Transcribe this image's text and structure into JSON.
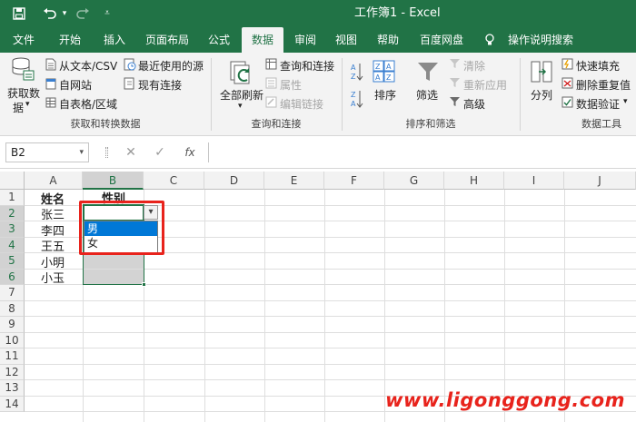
{
  "window": {
    "title": "工作簿1  -  Excel"
  },
  "quick_access": {
    "save_icon": "save-icon",
    "undo_icon": "undo-icon",
    "redo_icon": "redo-icon",
    "customize_icon": "customize-icon"
  },
  "tabs": [
    {
      "label": "文件"
    },
    {
      "label": "开始"
    },
    {
      "label": "插入"
    },
    {
      "label": "页面布局"
    },
    {
      "label": "公式"
    },
    {
      "label": "数据"
    },
    {
      "label": "审阅"
    },
    {
      "label": "视图"
    },
    {
      "label": "帮助"
    },
    {
      "label": "百度网盘"
    },
    {
      "label": "操作说明搜索"
    }
  ],
  "ribbon": {
    "get_data": {
      "line1": "获取数",
      "line2": "据",
      "arrow": "▾"
    },
    "from_text": "从文本/CSV",
    "from_web": "自网站",
    "from_table": "自表格/区域",
    "recent_sources": "最近使用的源",
    "existing_conn": "现有连接",
    "group1": "获取和转换数据",
    "refresh_all": "全部刷新",
    "refresh_arrow": "▾",
    "queries_conn": "查询和连接",
    "properties": "属性",
    "edit_links": "编辑链接",
    "group2": "查询和连接",
    "sort_az": "A Z",
    "sort_za": "Z A",
    "sort": "排序",
    "filter": "筛选",
    "clear": "清除",
    "reapply": "重新应用",
    "advanced": "高级",
    "group3": "排序和筛选",
    "split": "分列",
    "flash_fill": "快速填充",
    "remove_dup": "删除重复值",
    "data_valid": "数据验证",
    "data_valid_arrow": "▾",
    "group4": "数据工具"
  },
  "formula_bar": {
    "name_box": "B2",
    "name_box_arrow": "▾",
    "cancel": "✕",
    "enter": "✓",
    "fx": "fx",
    "value": ""
  },
  "columns": [
    "A",
    "B",
    "C",
    "D",
    "E",
    "F",
    "G",
    "H",
    "I",
    "J"
  ],
  "rows": [
    "1",
    "2",
    "3",
    "4",
    "5",
    "6",
    "7",
    "8",
    "9",
    "10",
    "11",
    "12",
    "13",
    "14"
  ],
  "cells": {
    "a1": "姓名",
    "b1": "性别",
    "a2": "张三",
    "a3": "李四",
    "a4": "王五",
    "a5": "小明",
    "a6": "小玉"
  },
  "dropdown": {
    "options": [
      "男",
      "女"
    ],
    "highlighted": 0,
    "arrow": "▾"
  },
  "watermark": "www.ligonggong.com",
  "colors": {
    "accent": "#217346",
    "highlight_box": "#e8231c",
    "selection": "#0078d7"
  }
}
